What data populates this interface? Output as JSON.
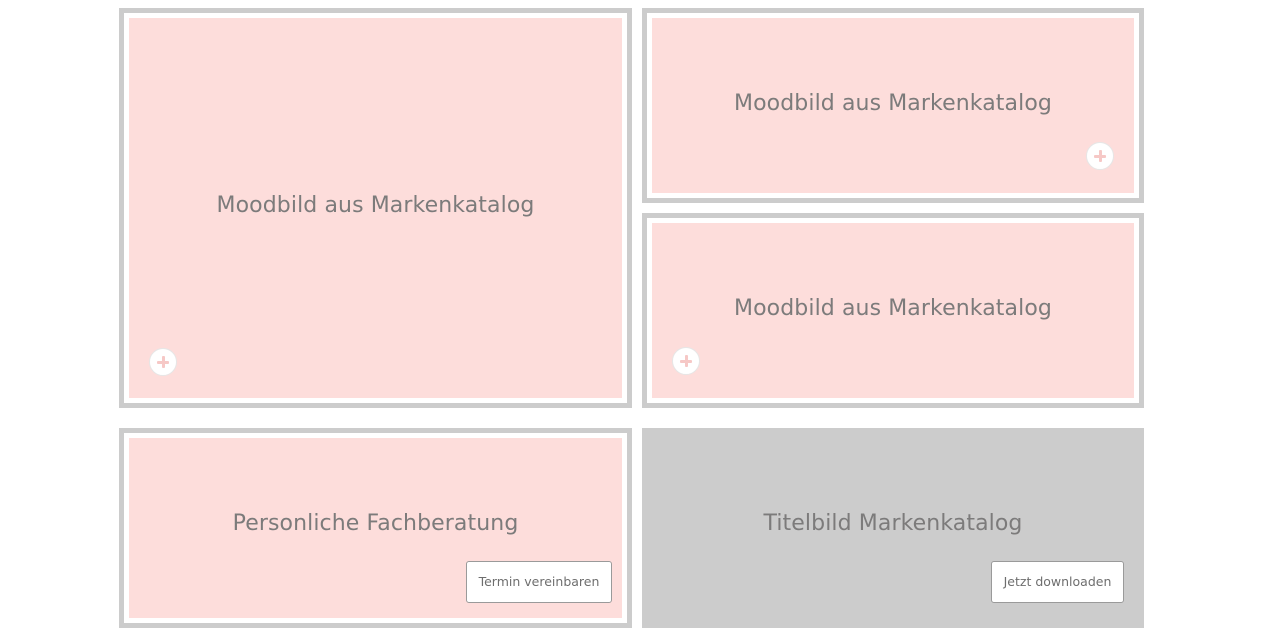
{
  "tiles": {
    "large": {
      "caption": "Moodbild aus Markenkatalog"
    },
    "top_right": {
      "caption": "Moodbild aus Markenkatalog"
    },
    "mid_right": {
      "caption": "Moodbild aus Markenkatalog"
    },
    "consult": {
      "caption": "Personliche Fachberatung",
      "button_label": "Termin vereinbaren"
    },
    "catalog": {
      "caption": "Titelbild Markenkatalog",
      "button_label": "Jetzt downloaden"
    }
  },
  "colors": {
    "tile_fill": "#fddddb",
    "tile_frame": "#cccccc",
    "catalog_fill": "#cccccc",
    "caption_text": "#7c7b7b"
  },
  "icons": [
    "plus-icon"
  ]
}
